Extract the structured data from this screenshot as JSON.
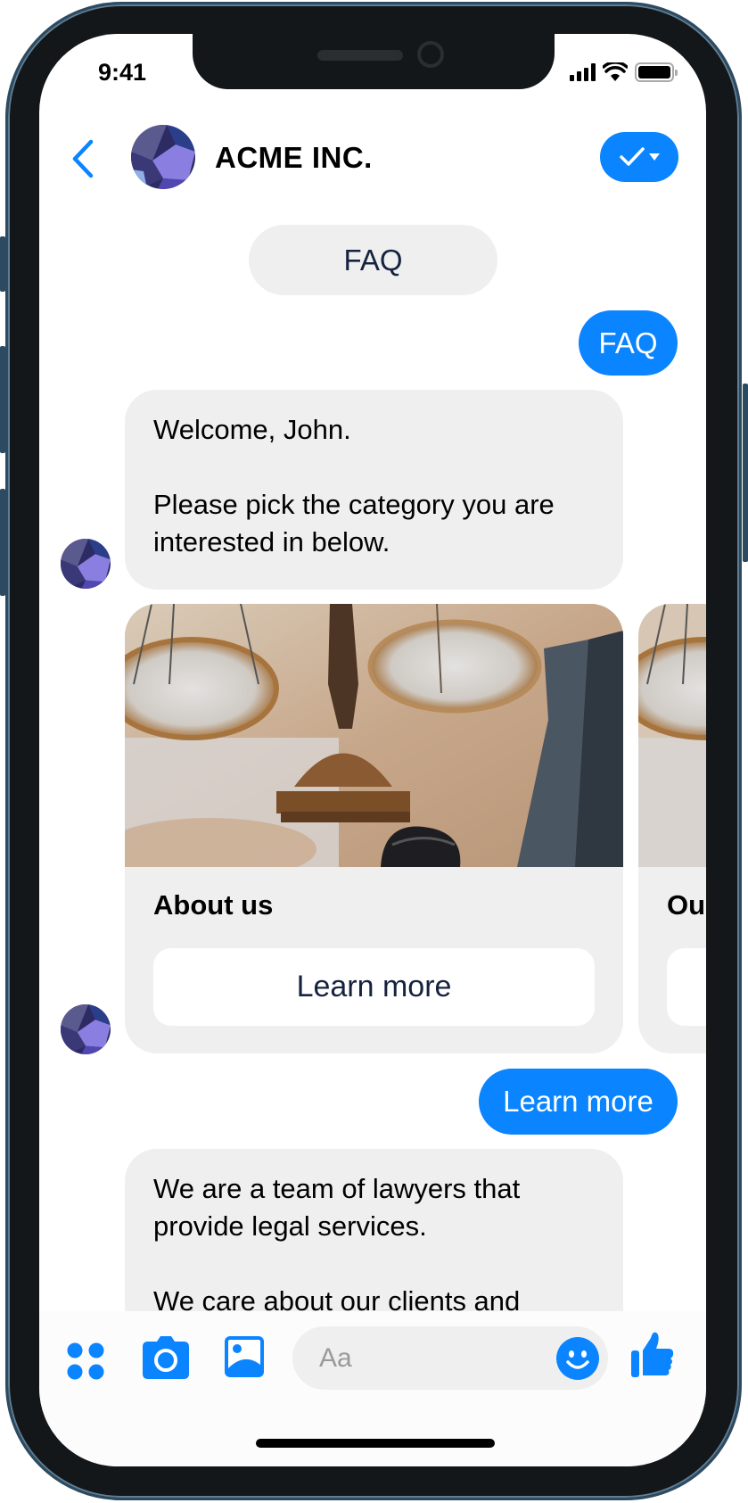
{
  "status_bar": {
    "time": "9:41"
  },
  "header": {
    "title": "ACME INC.",
    "back_icon": "chevron-left-icon",
    "verify_icon": "checkmark-dropdown-icon"
  },
  "messages": [
    {
      "type": "quick-reply",
      "text": "FAQ"
    },
    {
      "type": "outgoing",
      "text": "FAQ"
    },
    {
      "type": "incoming",
      "paragraphs": [
        "Welcome, John.",
        "Please pick the category you are interested in below."
      ]
    },
    {
      "type": "carousel",
      "cards": [
        {
          "title": "About us",
          "button": "Learn more"
        },
        {
          "title": "Ou",
          "button": ""
        }
      ]
    },
    {
      "type": "outgoing",
      "text": "Learn more"
    },
    {
      "type": "incoming",
      "paragraphs": [
        "We are a team of lawyers that provide legal services.",
        "We care about our clients and"
      ]
    }
  ],
  "composer": {
    "placeholder": "Aa",
    "icons": [
      "apps-icon",
      "camera-icon",
      "image-icon",
      "emoji-icon",
      "thumbs-up-icon"
    ]
  },
  "colors": {
    "accent": "#0a84ff",
    "bubble_gray": "#efefef",
    "text_dark": "#16233f"
  }
}
